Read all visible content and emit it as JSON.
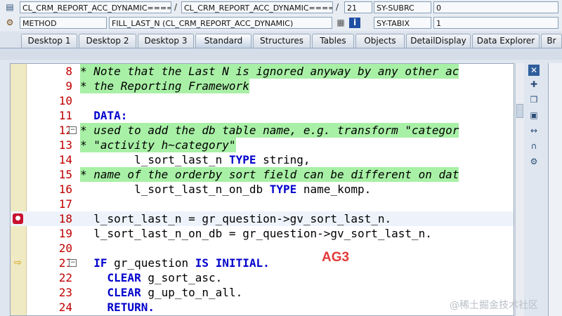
{
  "header": {
    "program": "CL_CRM_REPORT_ACC_DYNAMIC=====",
    "include": "CL_CRM_REPORT_ACC_DYNAMIC=====",
    "line_no": "21",
    "type": "METHOD",
    "method": "FILL_LAST_N (CL_CRM_REPORT_ACC_DYNAMIC)",
    "var1_name": "SY-SUBRC",
    "var1_value": "0",
    "var2_name": "SY-TABIX",
    "var2_value": "1"
  },
  "tabs": [
    "Desktop 1",
    "Desktop 2",
    "Desktop 3",
    "Standard",
    "Structures",
    "Tables",
    "Objects",
    "DetailDisplay",
    "Data Explorer",
    "Br"
  ],
  "active_tab": "Standard",
  "code_lines": [
    {
      "n": "8",
      "text": "* Note that the Last N is ignored anyway by any other ac",
      "comment": true
    },
    {
      "n": "9",
      "text": "* the Reporting Framework",
      "comment": true
    },
    {
      "n": "10",
      "text": ""
    },
    {
      "n": "11",
      "text": "  DATA:"
    },
    {
      "n": "12",
      "text": "* used to add the db table name, e.g. transform \"categor",
      "comment": true
    },
    {
      "n": "13",
      "text": "* \"activity h~category\"",
      "comment": true
    },
    {
      "n": "14",
      "text": "        l_sort_last_n TYPE string,"
    },
    {
      "n": "15",
      "text": "* name of the orderby sort field can be different on dat",
      "comment": true
    },
    {
      "n": "16",
      "text": "        l_sort_last_n_on_db TYPE name_komp."
    },
    {
      "n": "17",
      "text": ""
    },
    {
      "n": "18",
      "text": "  l_sort_last_n = gr_question->gv_sort_last_n."
    },
    {
      "n": "19",
      "text": "  l_sort_last_n_on_db = gr_question->gv_sort_last_n."
    },
    {
      "n": "20",
      "text": ""
    },
    {
      "n": "21",
      "text": "  IF gr_question IS INITIAL."
    },
    {
      "n": "22",
      "text": "    CLEAR g_sort_asc."
    },
    {
      "n": "23",
      "text": "    CLEAR g_up_to_n_all."
    },
    {
      "n": "24",
      "text": "    RETURN."
    }
  ],
  "annotation": "AG3",
  "watermark": "@稀土掘金技术社区",
  "colors": {
    "comment_bg": "#a8f0a6",
    "keyword": "#0000cc",
    "line_number": "#c00000",
    "annotation": "#e23a3a"
  }
}
